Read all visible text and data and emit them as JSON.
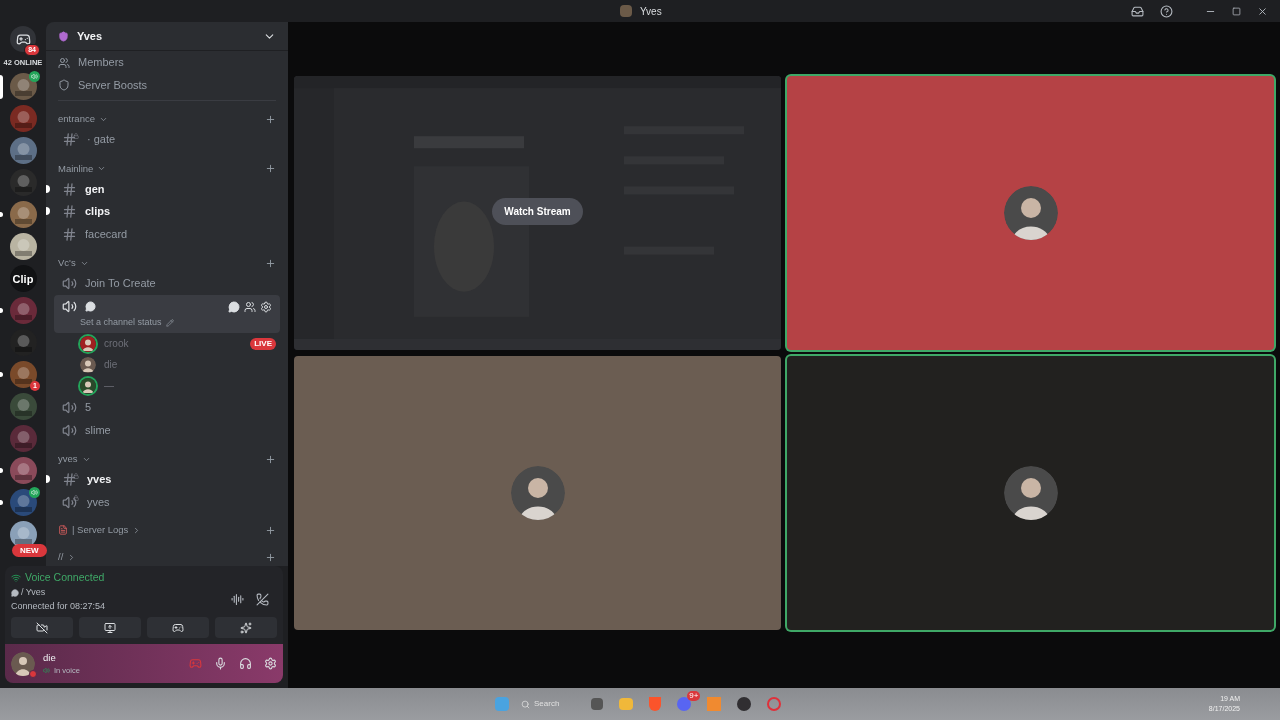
{
  "titlebar": {
    "title": "Yves"
  },
  "rail": {
    "home_badge": "84",
    "online": "42 ONLINE",
    "new_label": "NEW"
  },
  "servers": [
    {
      "selected": true,
      "unread": false,
      "speaker": true
    },
    {
      "selected": false,
      "unread": false,
      "speaker": false
    },
    {
      "selected": false,
      "unread": false,
      "speaker": false
    },
    {
      "selected": false,
      "unread": false,
      "speaker": false
    },
    {
      "selected": false,
      "unread": true,
      "speaker": false
    },
    {
      "selected": false,
      "unread": false,
      "speaker": false
    },
    {
      "kind": "text",
      "label": "Clip",
      "selected": false,
      "unread": false,
      "speaker": false
    },
    {
      "selected": false,
      "unread": true,
      "speaker": false
    },
    {
      "selected": false,
      "unread": false,
      "speaker": false
    },
    {
      "selected": false,
      "unread": true,
      "speaker": false,
      "badge": "1"
    },
    {
      "selected": false,
      "unread": false,
      "speaker": false
    },
    {
      "selected": false,
      "unread": false,
      "speaker": false
    },
    {
      "selected": false,
      "unread": true,
      "speaker": false
    },
    {
      "selected": false,
      "unread": true,
      "speaker": true
    },
    {
      "selected": false,
      "unread": false,
      "speaker": false
    }
  ],
  "server": {
    "name": "Yves",
    "top_items": [
      {
        "kind": "members",
        "label": "Members"
      },
      {
        "kind": "boosts",
        "label": "Server Boosts"
      }
    ]
  },
  "categories": [
    {
      "name": "entrance",
      "collapsed": false,
      "channels": [
        {
          "kind": "text-locked",
          "name": "· gate",
          "unread": false
        }
      ]
    },
    {
      "name": "Mainline",
      "collapsed": false,
      "channels": [
        {
          "kind": "text",
          "name": "gen",
          "unread": true
        },
        {
          "kind": "text",
          "name": "clips",
          "unread": true
        },
        {
          "kind": "text",
          "name": "facecard",
          "unread": false
        }
      ]
    },
    {
      "name": "Vc's",
      "collapsed": false,
      "channels": [
        {
          "kind": "voice",
          "name": "Join To Create",
          "unread": false
        },
        {
          "kind": "voice-active",
          "selected": true,
          "status": "Set a channel status",
          "members": [
            {
              "name": "crook",
              "live": "LIVE",
              "ring": true
            },
            {
              "name": "die",
              "ring": false
            },
            {
              "name": "—",
              "ring": true
            }
          ]
        },
        {
          "kind": "voice",
          "name": "5",
          "unread": false
        },
        {
          "kind": "voice",
          "name": "slime",
          "unread": false
        }
      ]
    },
    {
      "name": "yves",
      "collapsed": false,
      "channels": [
        {
          "kind": "text-locked",
          "name": "yves",
          "unread": true
        },
        {
          "kind": "voice-locked",
          "name": "yves",
          "unread": false
        }
      ]
    },
    {
      "name": "| Server Logs",
      "collapsed": true,
      "kind": "logs"
    },
    {
      "name": "//",
      "collapsed": true
    }
  ],
  "voice": {
    "title": "Voice Connected",
    "channel": "/ Yves",
    "duration": "Connected for 08:27:54"
  },
  "user": {
    "name": "die",
    "status": "In voice"
  },
  "tiles": [
    {
      "kind": "stream",
      "button": "Watch Stream",
      "speaking": false
    },
    {
      "kind": "avatar",
      "color": "#b54245",
      "speaking": true
    },
    {
      "kind": "avatar",
      "color": "#6b5d52",
      "speaking": false
    },
    {
      "kind": "avatar",
      "color": "#22211f",
      "speaking": true
    }
  ],
  "taskbar": {
    "search": "Search",
    "time": "19 AM",
    "date": "8/17/2025",
    "badge": "9+"
  }
}
